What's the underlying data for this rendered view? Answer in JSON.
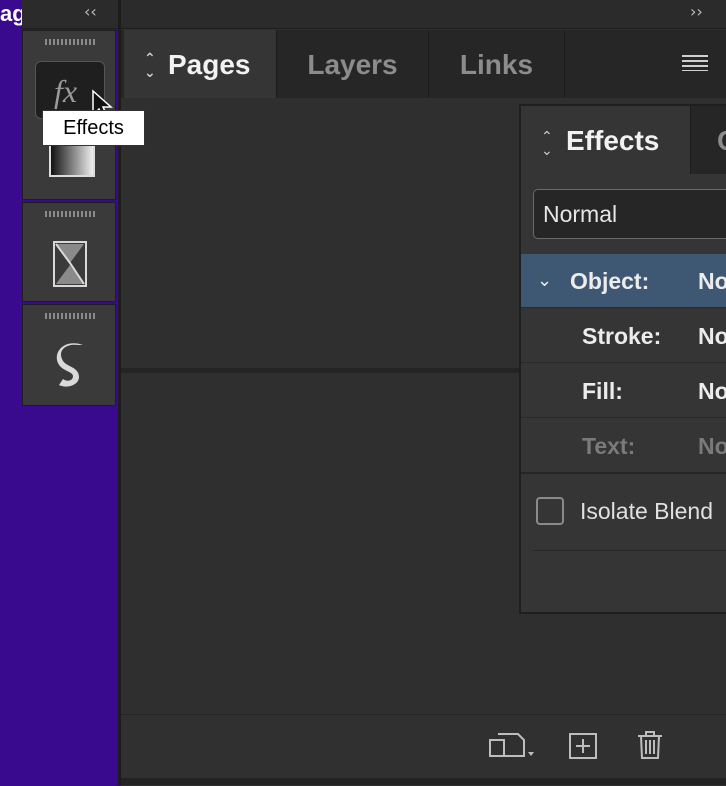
{
  "page_label": "ag",
  "strip": {
    "collapse_glyph": "‹‹",
    "icons": [
      "fx-icon",
      "gradient-swatch-icon",
      "hourglass-icon",
      "glyph-s-icon"
    ]
  },
  "tooltip": "Effects",
  "main_panel": {
    "collapse_glyph": "››",
    "tabs": [
      {
        "label": "Pages",
        "active": true
      },
      {
        "label": "Layers",
        "active": false
      },
      {
        "label": "Links",
        "active": false
      }
    ],
    "footer_icons": [
      "edit-page-size-icon",
      "new-page-icon",
      "delete-page-icon"
    ]
  },
  "effects_panel": {
    "tab_label": "Effects",
    "next_tab_partial": "C",
    "blend_mode": "Normal",
    "rows": [
      {
        "label": "Object:",
        "value": "No",
        "selected": true
      },
      {
        "label": "Stroke:",
        "value": "No"
      },
      {
        "label": "Fill:",
        "value": "No"
      },
      {
        "label": "Text:",
        "value": "No",
        "disabled": true
      }
    ],
    "isolate_label": "Isolate Blend"
  },
  "colors": {
    "canvas": "#3a0a8e",
    "panel": "#353535",
    "selected_row": "#3e5772"
  }
}
